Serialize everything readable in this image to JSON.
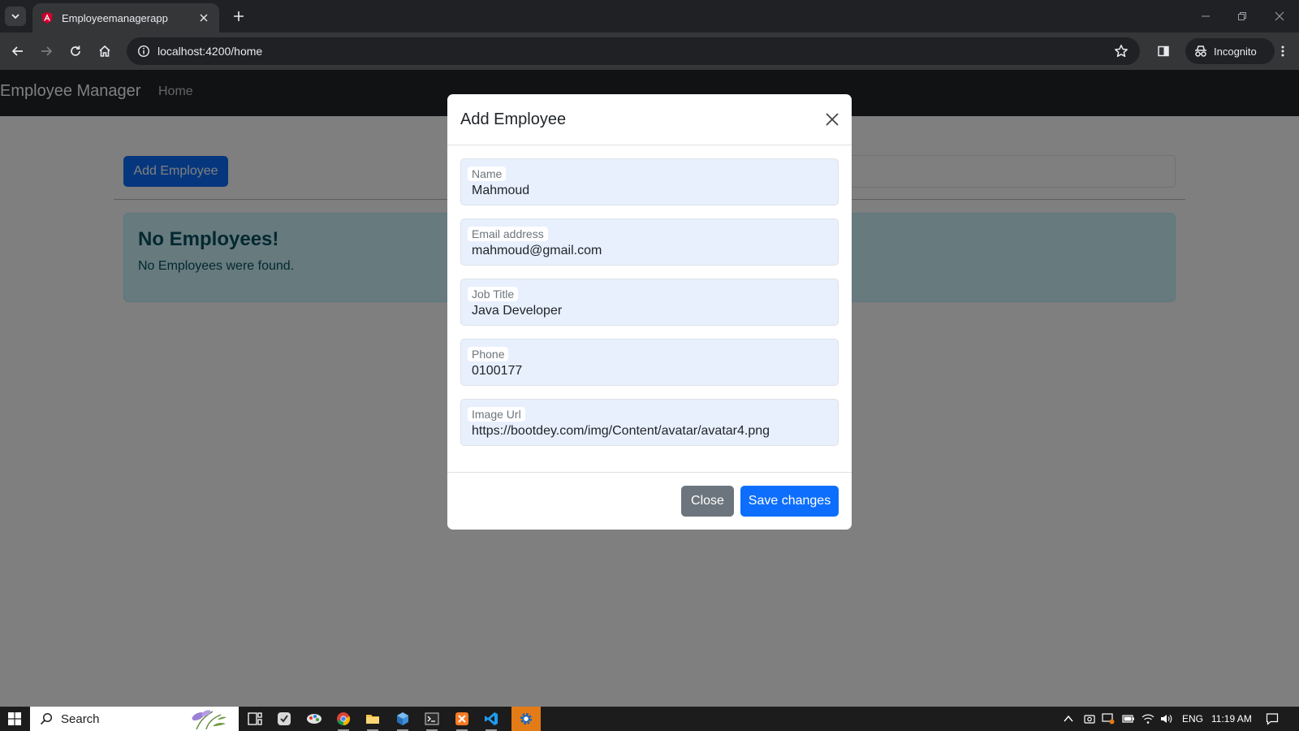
{
  "browser": {
    "tab_title": "Employeemanagerapp",
    "url": "localhost:4200/home",
    "incognito_label": "Incognito"
  },
  "navbar": {
    "brand": "Employee Manager",
    "home_link": "Home"
  },
  "main": {
    "add_button": "Add Employee",
    "alert_heading": "No Employees!",
    "alert_text": "No Employees were found."
  },
  "modal": {
    "title": "Add Employee",
    "fields": [
      {
        "label": "Name",
        "value": "Mahmoud"
      },
      {
        "label": "Email address",
        "value": "mahmoud@gmail.com"
      },
      {
        "label": "Job Title",
        "value": "Java Developer"
      },
      {
        "label": "Phone",
        "value": "0100177"
      },
      {
        "label": "Image Url",
        "value": "https://bootdey.com/img/Content/avatar/avatar4.png"
      }
    ],
    "close_button": "Close",
    "save_button": "Save changes"
  },
  "taskbar": {
    "search_label": "Search",
    "language": "ENG",
    "time": "11:19 AM"
  },
  "colors": {
    "primary": "#0d6efd",
    "secondary": "#6c757d",
    "navbar_bg": "#212529",
    "alert_bg": "#cff4fc",
    "alert_text": "#055160",
    "autofill_bg": "#e8f0fe"
  },
  "icons": {
    "tab_favicon": "angular-logo-icon",
    "back": "arrow-left-icon",
    "forward": "arrow-right-icon",
    "reload": "reload-icon",
    "home": "home-icon",
    "bookmark": "star-icon",
    "incognito": "incognito-icon"
  }
}
